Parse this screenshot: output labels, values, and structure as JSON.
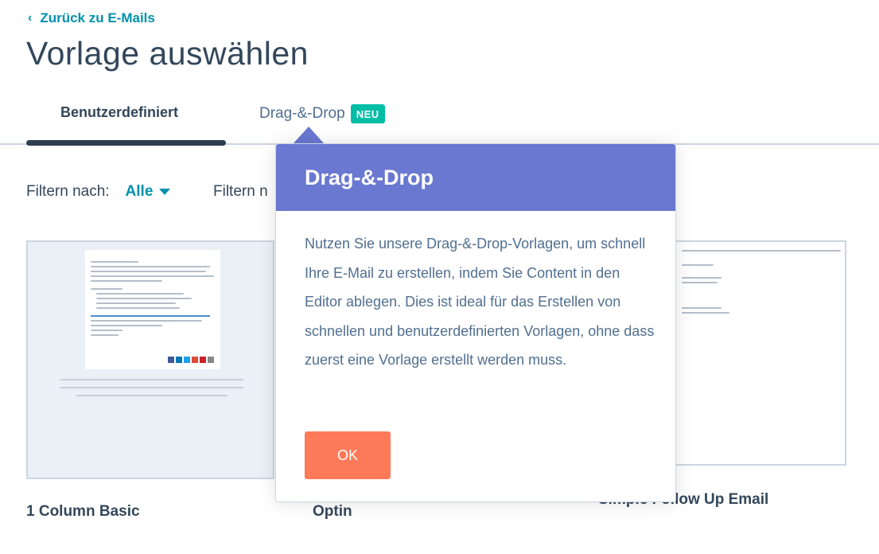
{
  "nav": {
    "back_label": "Zurück zu E-Mails"
  },
  "page": {
    "title": "Vorlage auswählen"
  },
  "tabs": [
    {
      "label": "Benutzerdefiniert"
    },
    {
      "label": "Drag-&-Drop",
      "badge": "NEU"
    }
  ],
  "filters": {
    "label": "Filtern nach:",
    "value": "Alle",
    "second_label": "Filtern n"
  },
  "templates": [
    {
      "name": "1 Column Basic"
    },
    {
      "name": "Optin"
    },
    {
      "name": "Simple Follow Up Email"
    }
  ],
  "popover": {
    "title": "Drag-&-Drop",
    "body": "Nutzen Sie unsere Drag-&-Drop-Vorlagen, um schnell Ihre E-Mail zu erstellen, indem Sie Content in den Editor ablegen. Dies ist ideal für das Erstellen von schnellen und benutzerdefinierten Vorlagen, ohne dass zuerst eine Vorlage erstellt werden muss.",
    "ok_label": "OK"
  },
  "colors": {
    "link": "#0091ae",
    "badge": "#00bda5",
    "popover_header": "#6a78d1",
    "ok_button": "#ff7a59",
    "text": "#33475b"
  }
}
